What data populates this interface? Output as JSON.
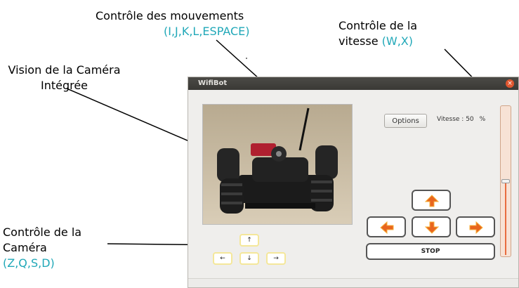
{
  "annotations": {
    "movement": {
      "title": "Contrôle des mouvements",
      "keys": "(I,J,K,L,ESPACE)"
    },
    "speed": {
      "title_line1": "Contrôle de la",
      "title_line2": "vitesse",
      "keys": "(W,X)"
    },
    "camera_view": {
      "line1": "Vision de la Caméra",
      "line2": "Intégrée"
    },
    "camera_control": {
      "line1": "Contrôle de la",
      "line2": "Caméra",
      "keys": "(Z,Q,S,D)"
    }
  },
  "window": {
    "title": "WifiBot",
    "close_glyph": "×"
  },
  "controls": {
    "options_label": "Options",
    "speed_label": "Vitesse : 50",
    "speed_unit": "%",
    "speed_value": 0.5,
    "stop_label": "STOP"
  },
  "camera_buttons": {
    "up": "↑",
    "left": "←",
    "down": "↓",
    "right": "→"
  },
  "icons": {
    "move_up": "arrow-up-icon",
    "move_left": "arrow-left-icon",
    "move_down": "arrow-down-icon",
    "move_right": "arrow-right-icon"
  },
  "colors": {
    "accent": "#21a8b8",
    "arrow": "#e8651e",
    "arrow_light": "#f7b13a",
    "slider_fill": "#e86c3f"
  }
}
